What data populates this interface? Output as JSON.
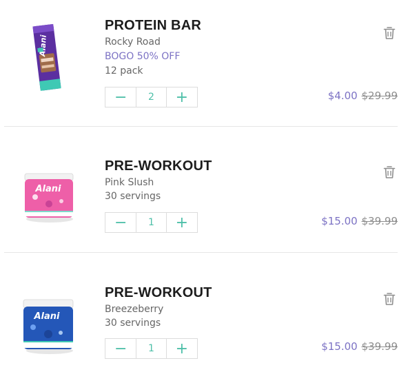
{
  "items": [
    {
      "thumbnail_icon": "protein-bar-image",
      "name": "PROTEIN BAR",
      "flavor": "Rocky Road",
      "promo": "BOGO 50% OFF",
      "size": "12 pack",
      "quantity": "2",
      "price": "$4.00",
      "original_price": "$29.99"
    },
    {
      "thumbnail_icon": "pre-workout-pink-tub-image",
      "name": "PRE-WORKOUT",
      "flavor": "Pink Slush",
      "size": "30 servings",
      "quantity": "1",
      "price": "$15.00",
      "original_price": "$39.99"
    },
    {
      "thumbnail_icon": "pre-workout-blue-tub-image",
      "name": "PRE-WORKOUT",
      "flavor": "Breezeberry",
      "size": "30 servings",
      "quantity": "1",
      "price": "$15.00",
      "original_price": "$39.99"
    }
  ],
  "controls": {
    "decrement_symbol": "−",
    "increment_symbol": "+"
  },
  "colors": {
    "accent_teal": "#4dbfa8",
    "promo_purple": "#7c72c4",
    "product_name": "#1c1c1c"
  }
}
